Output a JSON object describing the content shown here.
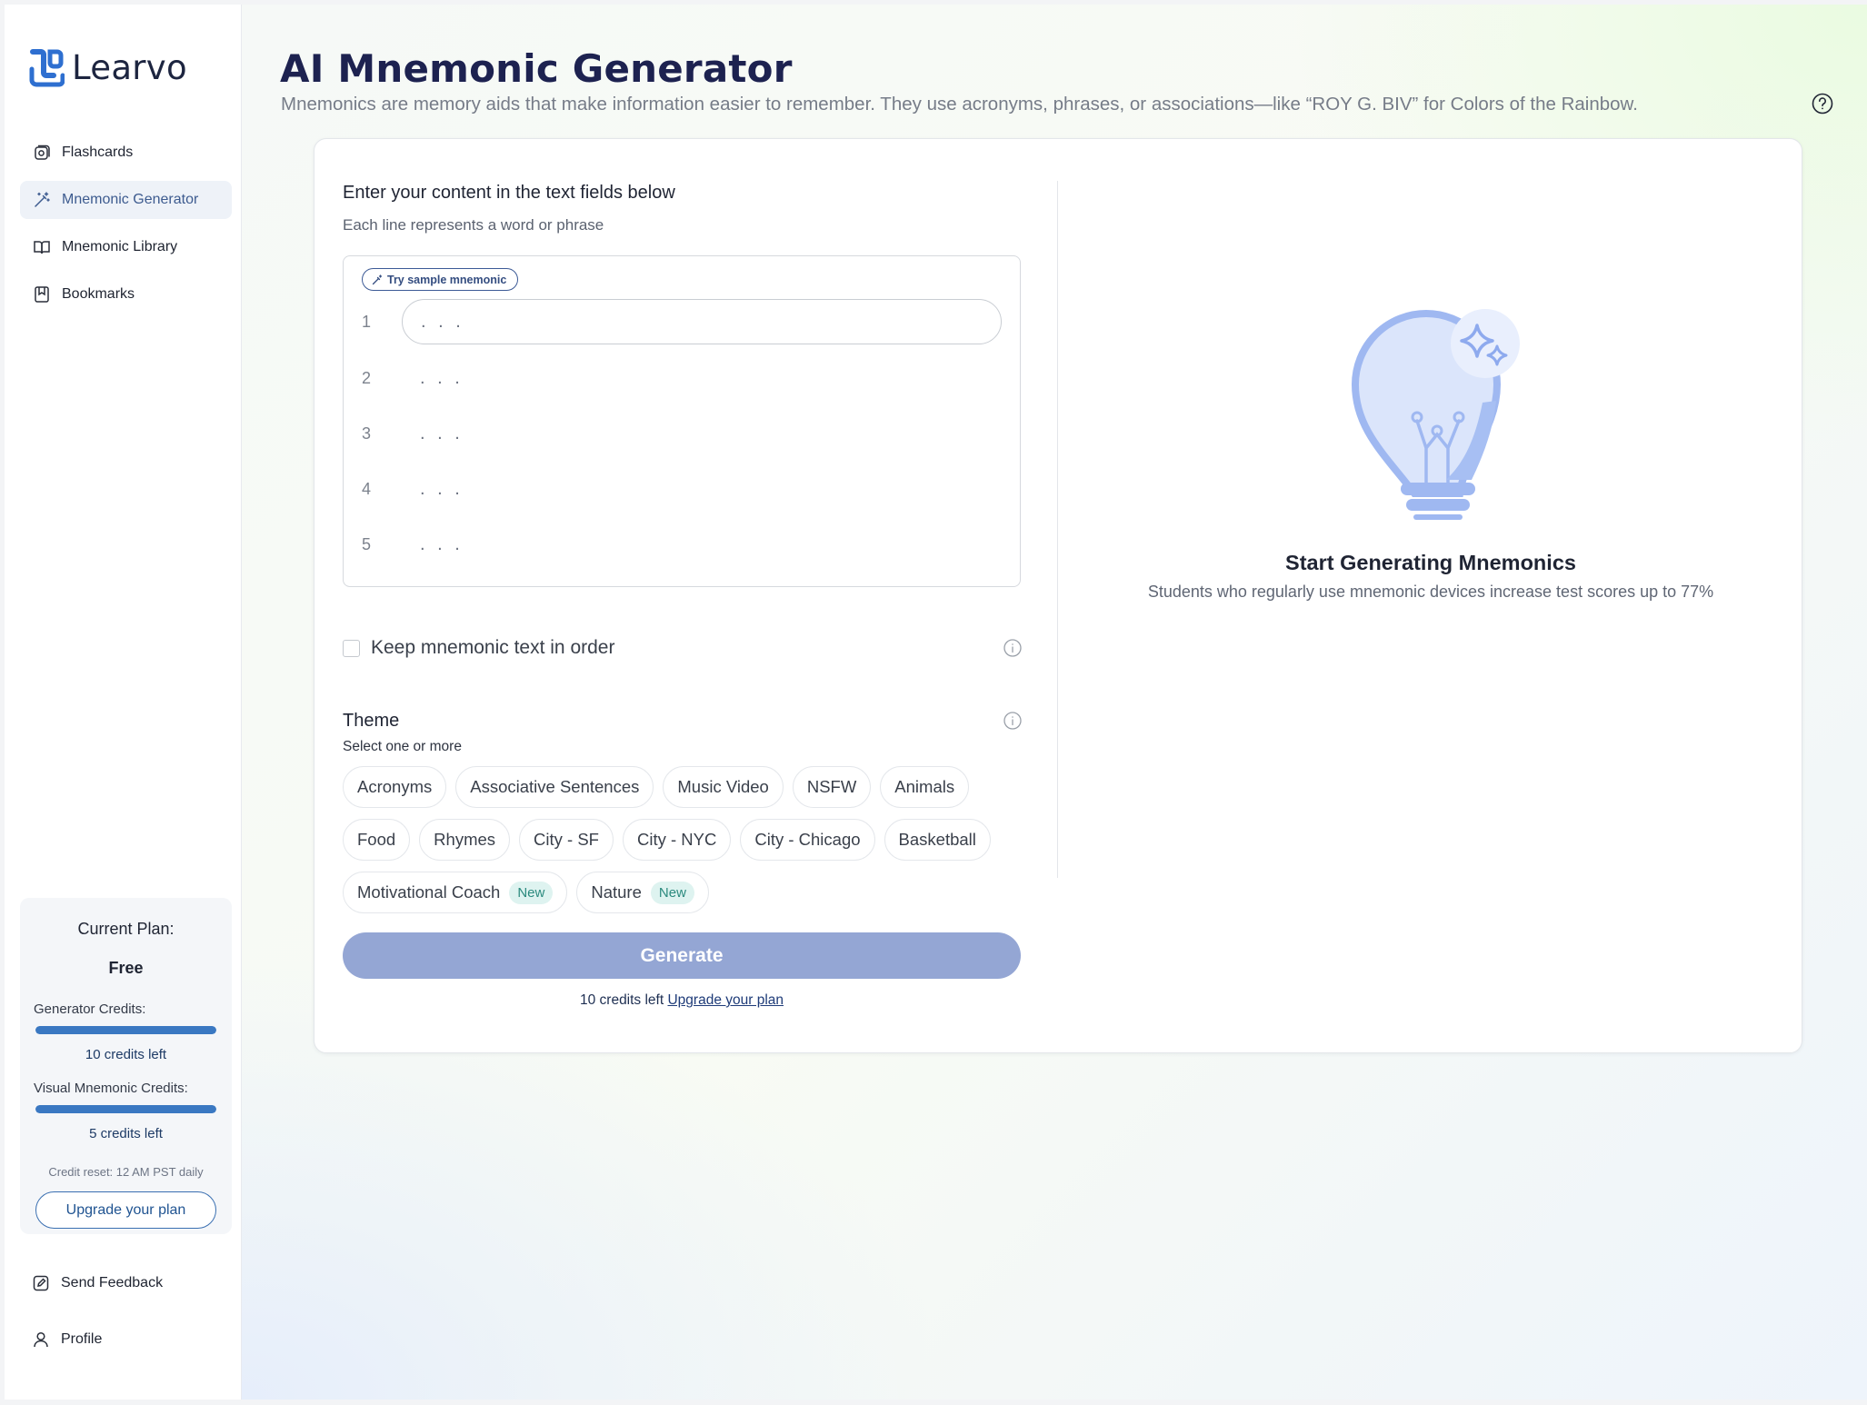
{
  "app": {
    "name": "Learvo"
  },
  "sidebar": {
    "items": [
      {
        "label": "Flashcards",
        "icon": "flashcards-icon"
      },
      {
        "label": "Mnemonic Generator",
        "icon": "magic-wand-icon"
      },
      {
        "label": "Mnemonic Library",
        "icon": "book-icon"
      },
      {
        "label": "Bookmarks",
        "icon": "bookmark-icon"
      }
    ],
    "active_index": 1,
    "bottom_items": [
      {
        "label": "Send Feedback",
        "icon": "feedback-icon"
      },
      {
        "label": "Profile",
        "icon": "user-icon"
      }
    ]
  },
  "plan": {
    "title": "Current Plan:",
    "name": "Free",
    "generator_label": "Generator Credits:",
    "generator_left": "10 credits left",
    "generator_fraction": 1.0,
    "visual_label": "Visual Mnemonic Credits:",
    "visual_left": "5 credits left",
    "visual_fraction": 1.0,
    "reset": "Credit reset: 12 AM PST daily",
    "upgrade_label": "Upgrade your plan"
  },
  "header": {
    "title": "AI Mnemonic Generator",
    "subtitle": "Mnemonics are memory aids that make information easier to remember. They use acronyms, phrases, or associations—like “ROY G. BIV” for Colors of the Rainbow."
  },
  "form": {
    "title": "Enter your content in the text fields below",
    "subtitle": "Each line represents a word or phrase",
    "sample_label": "Try sample mnemonic",
    "lines": [
      {
        "num": "1",
        "placeholder": ". . .",
        "value": ""
      },
      {
        "num": "2",
        "placeholder": ". . .",
        "value": ""
      },
      {
        "num": "3",
        "placeholder": ". . .",
        "value": ""
      },
      {
        "num": "4",
        "placeholder": ". . .",
        "value": ""
      },
      {
        "num": "5",
        "placeholder": ". . .",
        "value": ""
      }
    ],
    "keep_order_label": "Keep mnemonic text in order",
    "keep_order_checked": false,
    "theme_title": "Theme",
    "theme_subtitle": "Select one or more",
    "themes": [
      [
        "Acronyms",
        "Associative Sentences",
        "Music Video",
        "NSFW",
        "Animals"
      ],
      [
        "Food",
        "Rhymes",
        "City - SF",
        "City - NYC",
        "City - Chicago",
        "Basketball"
      ],
      [
        "Motivational Coach",
        "Nature"
      ]
    ],
    "new_badge": "New",
    "new_themes": [
      "Motivational Coach",
      "Nature"
    ],
    "generate_label": "Generate",
    "credits_text": "10 credits left",
    "upgrade_link": "Upgrade your plan"
  },
  "empty_state": {
    "title": "Start Generating Mnemonics",
    "subtitle": "Students who regularly use mnemonic devices increase test scores up to 77%"
  },
  "colors": {
    "accent": "#3a78c2",
    "generate_disabled": "#94a6d4",
    "title": "#1d2250",
    "badge_bg": "#def3f0",
    "badge_text": "#2b8a7e"
  }
}
